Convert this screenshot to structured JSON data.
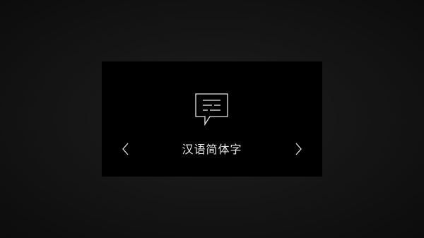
{
  "language_selector": {
    "current_language": "汉语简体字",
    "icons": {
      "language": "speech-bubble-icon",
      "previous": "chevron-left-icon",
      "next": "chevron-right-icon"
    },
    "colors": {
      "panel_background": "#000000",
      "page_background": "#161616",
      "foreground": "#e6e6e6"
    }
  }
}
